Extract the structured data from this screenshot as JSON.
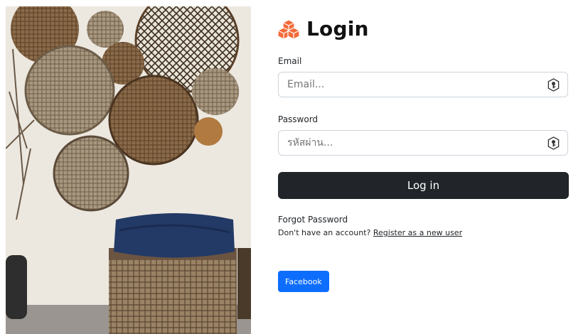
{
  "brand": {
    "title": "Login",
    "icon": "boxes-icon",
    "icon_color": "#f26b3a"
  },
  "form": {
    "email_label": "Email",
    "email_placeholder": "Email...",
    "password_label": "Password",
    "password_placeholder": "รหัสผ่าน...",
    "field_icon": "key-badge-icon",
    "submit_label": "Log in",
    "forgot_label": "Forgot Password",
    "register_prompt": "Don't have an account?",
    "register_link": "Register as a new user"
  },
  "external_login": {
    "facebook_label": "Facebook",
    "color": "#0d6efd"
  },
  "photo": {
    "icon": "baskets-photo"
  }
}
